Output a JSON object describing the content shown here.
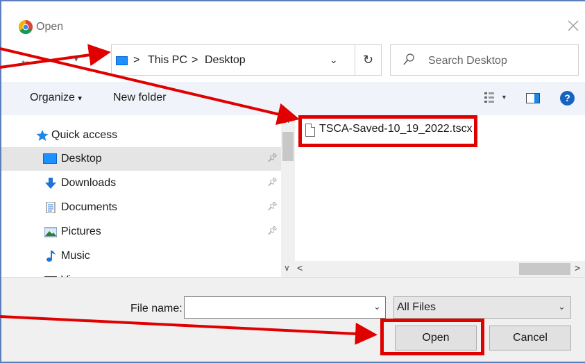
{
  "window": {
    "title": "Open"
  },
  "address_bar": {
    "segments": [
      "This PC",
      "Desktop"
    ],
    "separator": ">"
  },
  "search": {
    "placeholder": "Search Desktop"
  },
  "toolbar": {
    "organize": "Organize",
    "organize_caret": "▾",
    "new_folder": "New folder",
    "help": "?"
  },
  "nav_pane": {
    "items": [
      {
        "label": "Quick access",
        "icon": "star-icon"
      },
      {
        "label": "Desktop",
        "icon": "desktop-folder-icon",
        "selected": true,
        "pinned": true
      },
      {
        "label": "Downloads",
        "icon": "download-arrow-icon",
        "pinned": true
      },
      {
        "label": "Documents",
        "icon": "documents-icon",
        "pinned": true
      },
      {
        "label": "Pictures",
        "icon": "pictures-icon",
        "pinned": true
      },
      {
        "label": "Music",
        "icon": "music-note-icon"
      },
      {
        "label": "Vi",
        "icon": "videos-icon"
      }
    ]
  },
  "files": [
    {
      "name": "TSCA-Saved-10_19_2022.tscx",
      "icon": "file-icon"
    }
  ],
  "bottom": {
    "file_name_label": "File name:",
    "file_name_value": "",
    "file_type": "All Files",
    "open_button": "Open",
    "cancel_button": "Cancel"
  },
  "annotation_color": "#e00000"
}
